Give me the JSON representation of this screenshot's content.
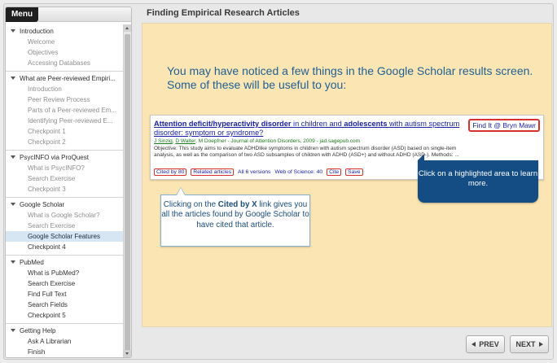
{
  "menu": {
    "tab_label": "Menu",
    "sections": [
      {
        "title": "Introduction",
        "items": [
          {
            "label": "Welcome",
            "state": "visited"
          },
          {
            "label": "Objectives",
            "state": "visited"
          },
          {
            "label": "Accessing Databases",
            "state": "visited"
          }
        ]
      },
      {
        "title": "What are Peer-reviewed Empiri...",
        "items": [
          {
            "label": "Introduction",
            "state": "visited"
          },
          {
            "label": "Peer Review Process",
            "state": "visited"
          },
          {
            "label": "Parts of a Peer-reviewed Em...",
            "state": "visited"
          },
          {
            "label": "Identifying Peer-reviewed E...",
            "state": "visited"
          },
          {
            "label": "Checkpoint 1",
            "state": "visited"
          },
          {
            "label": "Checkpoint 2",
            "state": "visited"
          }
        ]
      },
      {
        "title": "PsycINFO via ProQuest",
        "items": [
          {
            "label": "What is PsycINFO?",
            "state": "visited"
          },
          {
            "label": "Search Exercise",
            "state": "visited"
          },
          {
            "label": "Checkpoint 3",
            "state": "visited"
          }
        ]
      },
      {
        "title": "Google Scholar",
        "items": [
          {
            "label": "What is Google Scholar?",
            "state": "visited"
          },
          {
            "label": "Search Exercise",
            "state": "visited"
          },
          {
            "label": "Google Scholar Features",
            "state": "selected"
          },
          {
            "label": "Checkpoint 4",
            "state": "active"
          }
        ]
      },
      {
        "title": "PubMed",
        "items": [
          {
            "label": "What is PubMed?",
            "state": "active"
          },
          {
            "label": "Search Exercise",
            "state": "active"
          },
          {
            "label": "Find Full Text",
            "state": "active"
          },
          {
            "label": "Search Fields",
            "state": "active"
          },
          {
            "label": "Checkpoint 5",
            "state": "active"
          }
        ]
      },
      {
        "title": "Getting Help",
        "items": [
          {
            "label": "Ask A Librarian",
            "state": "active"
          },
          {
            "label": "Finish",
            "state": "active"
          }
        ]
      }
    ]
  },
  "main": {
    "title": "Finding Empirical Research Articles",
    "intro_line1": "You may have noticed a few things in the Google Scholar results screen.",
    "intro_line2": "Some of these will be useful to you:"
  },
  "result": {
    "title_part1": "Attention deficit/hyperactivity disorder",
    "title_part2": " in children and ",
    "title_part3": "adolescents",
    "title_part4": " with autism spectrum disorder: symptom or syndrome?",
    "find_it": "Find It @ Bryn Mawr",
    "authors_1": "J Sinzig",
    "authors_sep": ", ",
    "authors_2": "D Walter",
    "authors_rest": ", M Doepfner - Journal of Attention Disorders, 2009 - jad.sagepub.com",
    "snippet": "Objective: This study aims to evaluate ADHDlike symptoms in children with autism spectrum disorder (ASD) based on single-item analysis, as well as the comparison of two ASD subsamples of children with ADHD (ASD+) and without ADHD (ASD-). Methods: ...",
    "links": {
      "cited_by": "Cited by 80",
      "related": "Related articles",
      "versions": "All 6 versions",
      "wos": "Web of Science: 40",
      "cite": "Cite",
      "save": "Save"
    }
  },
  "callouts": {
    "right": "Click on a highlighted area to learn more.",
    "left_pre": "Clicking on the ",
    "left_bold": "Cited by X",
    "left_post": " link gives you all the articles found by Google Scholar to have cited that article."
  },
  "nav": {
    "prev": "PREV",
    "next": "NEXT"
  }
}
